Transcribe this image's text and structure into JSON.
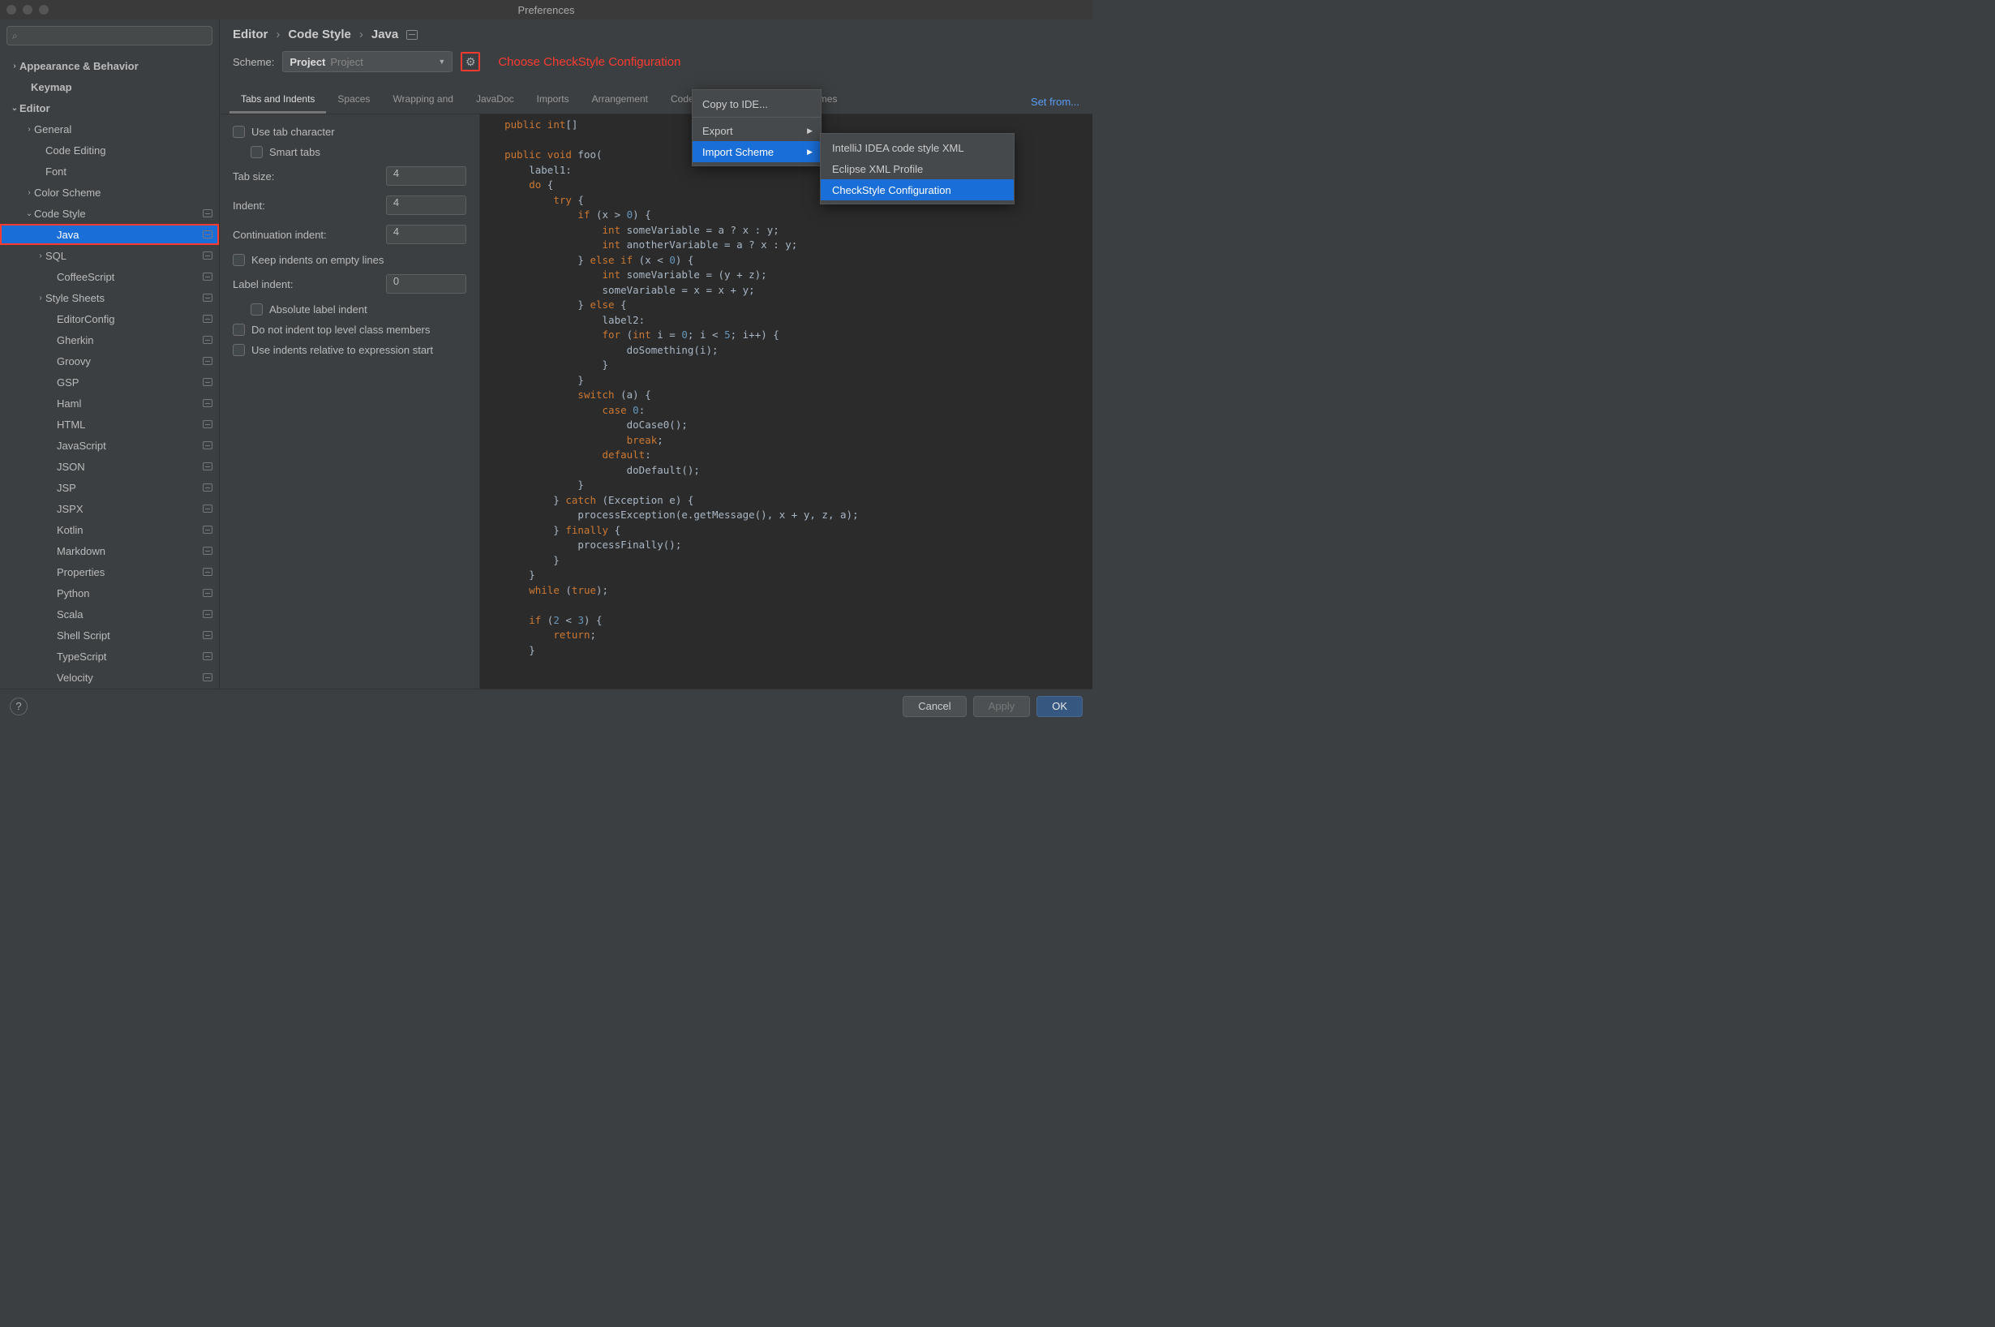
{
  "title": "Preferences",
  "search_placeholder": "",
  "sidebar": {
    "items": [
      {
        "label": "Appearance & Behavior",
        "indent": 12,
        "chevron": "›",
        "bold": true
      },
      {
        "label": "Keymap",
        "indent": 26,
        "bold": true
      },
      {
        "label": "Editor",
        "indent": 12,
        "chevron": "⌄",
        "bold": true
      },
      {
        "label": "General",
        "indent": 30,
        "chevron": "›",
        "badge": false
      },
      {
        "label": "Code Editing",
        "indent": 44,
        "badge": false
      },
      {
        "label": "Font",
        "indent": 44,
        "badge": false
      },
      {
        "label": "Color Scheme",
        "indent": 30,
        "chevron": "›",
        "badge": false
      },
      {
        "label": "Code Style",
        "indent": 30,
        "chevron": "⌄",
        "badge": true
      },
      {
        "label": "Java",
        "indent": 58,
        "selected": true,
        "highlighted": true,
        "badge": true
      },
      {
        "label": "SQL",
        "indent": 44,
        "chevron": "›",
        "badge": true
      },
      {
        "label": "CoffeeScript",
        "indent": 58,
        "badge": true
      },
      {
        "label": "Style Sheets",
        "indent": 44,
        "chevron": "›",
        "badge": true
      },
      {
        "label": "EditorConfig",
        "indent": 58,
        "badge": true
      },
      {
        "label": "Gherkin",
        "indent": 58,
        "badge": true
      },
      {
        "label": "Groovy",
        "indent": 58,
        "badge": true
      },
      {
        "label": "GSP",
        "indent": 58,
        "badge": true
      },
      {
        "label": "Haml",
        "indent": 58,
        "badge": true
      },
      {
        "label": "HTML",
        "indent": 58,
        "badge": true
      },
      {
        "label": "JavaScript",
        "indent": 58,
        "badge": true
      },
      {
        "label": "JSON",
        "indent": 58,
        "badge": true
      },
      {
        "label": "JSP",
        "indent": 58,
        "badge": true
      },
      {
        "label": "JSPX",
        "indent": 58,
        "badge": true
      },
      {
        "label": "Kotlin",
        "indent": 58,
        "badge": true
      },
      {
        "label": "Markdown",
        "indent": 58,
        "badge": true
      },
      {
        "label": "Properties",
        "indent": 58,
        "badge": true
      },
      {
        "label": "Python",
        "indent": 58,
        "badge": true
      },
      {
        "label": "Scala",
        "indent": 58,
        "badge": true
      },
      {
        "label": "Shell Script",
        "indent": 58,
        "badge": true
      },
      {
        "label": "TypeScript",
        "indent": 58,
        "badge": true
      },
      {
        "label": "Velocity",
        "indent": 58,
        "badge": true
      }
    ]
  },
  "breadcrumb": [
    "Editor",
    "Code Style",
    "Java"
  ],
  "scheme": {
    "label": "Scheme:",
    "name": "Project",
    "detail": "Project"
  },
  "annotation": "Choose CheckStyle Configuration",
  "set_from": "Set from...",
  "tabs": [
    "Tabs and Indents",
    "Spaces",
    "Wrapping and",
    "JavaDoc",
    "Imports",
    "Arrangement",
    "Code Generation",
    "Java EE Names"
  ],
  "active_tab": 0,
  "popup": {
    "items": [
      {
        "label": "Copy to IDE..."
      },
      {
        "label": "Export",
        "arrow": true
      },
      {
        "label": "Import Scheme",
        "arrow": true,
        "selected": true
      }
    ],
    "submenu": [
      {
        "label": "IntelliJ IDEA code style XML"
      },
      {
        "label": "Eclipse XML Profile"
      },
      {
        "label": "CheckStyle Configuration",
        "selected": true
      }
    ]
  },
  "settings": {
    "use_tab_char": "Use tab character",
    "smart_tabs": "Smart tabs",
    "tab_size_label": "Tab size:",
    "tab_size": "4",
    "indent_label": "Indent:",
    "indent": "4",
    "cont_indent_label": "Continuation indent:",
    "cont_indent": "4",
    "keep_indents": "Keep indents on empty lines",
    "label_indent_label": "Label indent:",
    "label_indent": "0",
    "abs_label": "Absolute label indent",
    "no_top_indent": "Do not indent top level class members",
    "rel_indent": "Use indents relative to expression start"
  },
  "code_lines": [
    [
      "    ",
      "kw:public",
      " ",
      "kw:int",
      "[] ",
      ""
    ],
    [
      "",
      ""
    ],
    [
      "    ",
      "kw:public",
      " ",
      "kw:void",
      " foo(",
      ""
    ],
    [
      "        label1:"
    ],
    [
      "        ",
      "kw:do",
      " {"
    ],
    [
      "            ",
      "kw:try",
      " {"
    ],
    [
      "                ",
      "kw:if",
      " (x > ",
      "num:0",
      ") {"
    ],
    [
      "                    ",
      "kw:int",
      " someVariable = a ? x : y;"
    ],
    [
      "                    ",
      "kw:int",
      " anotherVariable = a ? x : y;"
    ],
    [
      "                } ",
      "kw:else if",
      " (x < ",
      "num:0",
      ") {"
    ],
    [
      "                    ",
      "kw:int",
      " someVariable = (y + z);"
    ],
    [
      "                    someVariable = x = x + y;"
    ],
    [
      "                } ",
      "kw:else",
      " {"
    ],
    [
      "                    label2:"
    ],
    [
      "                    ",
      "kw:for",
      " (",
      "kw:int",
      " i = ",
      "num:0",
      "; i < ",
      "num:5",
      "; i++) {"
    ],
    [
      "                        doSomething(i);"
    ],
    [
      "                    }"
    ],
    [
      "                }"
    ],
    [
      "                ",
      "kw:switch",
      " (a) {"
    ],
    [
      "                    ",
      "kw:case",
      " ",
      "num:0",
      ":"
    ],
    [
      "                        doCase0();"
    ],
    [
      "                        ",
      "kw:break",
      ";"
    ],
    [
      "                    ",
      "kw:default",
      ":"
    ],
    [
      "                        doDefault();"
    ],
    [
      "                }"
    ],
    [
      "            } ",
      "kw:catch",
      " (Exception e) {"
    ],
    [
      "                processException(e.getMessage(), x + y, z, a);"
    ],
    [
      "            } ",
      "kw:finally",
      " {"
    ],
    [
      "                processFinally();"
    ],
    [
      "            }"
    ],
    [
      "        }"
    ],
    [
      "        ",
      "kw:while",
      " (",
      "kw:true",
      ");"
    ],
    [
      "",
      ""
    ],
    [
      "        ",
      "kw:if",
      " (",
      "num:2",
      " < ",
      "num:3",
      ") {"
    ],
    [
      "            ",
      "kw:return",
      ";"
    ],
    [
      "        }"
    ]
  ],
  "footer": {
    "cancel": "Cancel",
    "apply": "Apply",
    "ok": "OK"
  }
}
